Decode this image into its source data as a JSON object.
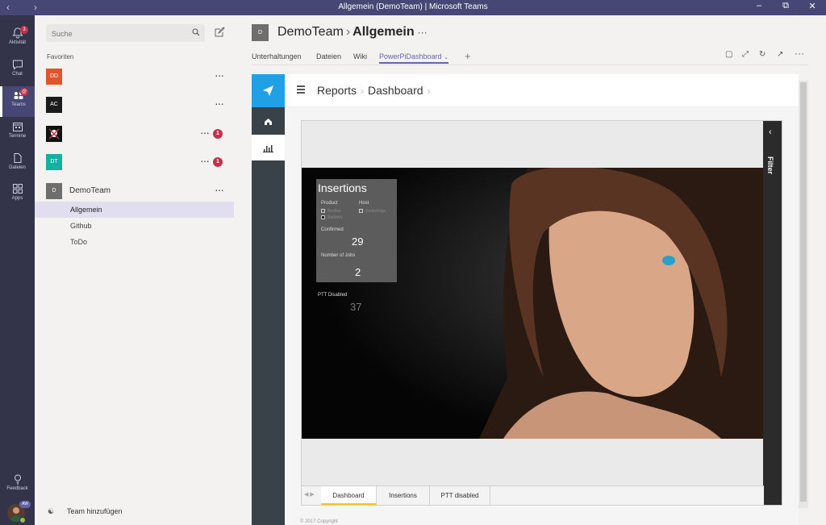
{
  "window": {
    "title": "Allgemein (DemoTeam) | Microsoft Teams",
    "back_icon": "chevron-left-icon",
    "forward_icon": "chevron-right-icon"
  },
  "rail": {
    "items": [
      {
        "label": "Aktivität",
        "icon": "bell-icon",
        "badge": "3"
      },
      {
        "label": "Chat",
        "icon": "chat-icon"
      },
      {
        "label": "Teams",
        "icon": "teams-icon",
        "badge": "@"
      },
      {
        "label": "Termine",
        "icon": "calendar-icon"
      },
      {
        "label": "Dateien",
        "icon": "file-icon"
      },
      {
        "label": "Apps",
        "icon": "apps-icon"
      }
    ],
    "feedback_label": "Feedback",
    "user_badge": "AW"
  },
  "panel": {
    "search_placeholder": "Suche",
    "favorites_label": "Favoriten",
    "teams": [
      {
        "initials": "DD",
        "color": "#e0542e",
        "name": ""
      },
      {
        "initials": "AC",
        "color": "#1b1b1b",
        "name": ""
      },
      {
        "initials": "",
        "color": "#111111",
        "name": "",
        "badge": "1"
      },
      {
        "initials": "DT",
        "color": "#13b1a0",
        "name": "",
        "badge": "1"
      },
      {
        "initials": "D",
        "color": "#6e6e6e",
        "name": "DemoTeam"
      }
    ],
    "channels": [
      "Allgemein",
      "Github",
      "ToDo"
    ],
    "add_team_label": "Team hinzufügen"
  },
  "header": {
    "avatar": "D",
    "team": "DemoTeam",
    "channel": "Allgemein",
    "tabs": [
      "Unterhaltungen",
      "Dateien",
      "Wiki",
      "PowerPiDashboard"
    ],
    "active_tab": "PowerPiDashboard"
  },
  "app": {
    "breadcrumb": [
      "Reports",
      "Dashboard"
    ],
    "brand_color": "#20a1e6"
  },
  "report": {
    "card_title": "Insertions",
    "product_label": "Product",
    "host_label": "Host",
    "product_options": [
      "Beeline",
      "BatMAN"
    ],
    "host_options": [
      "Seakefelge"
    ],
    "confirmed_label": "Confirmed",
    "confirmed_value": "29",
    "jobs_label": "Number of Jobs",
    "jobs_value": "2",
    "ptt_label": "PTT Disabled",
    "ptt_value": "37",
    "filter_label": "Filter",
    "page_tabs": [
      "Dashboard",
      "Insertions",
      "PTT disabled"
    ],
    "active_page": "Dashboard"
  },
  "footer": {
    "copyright": "© 2017 Copyright"
  }
}
